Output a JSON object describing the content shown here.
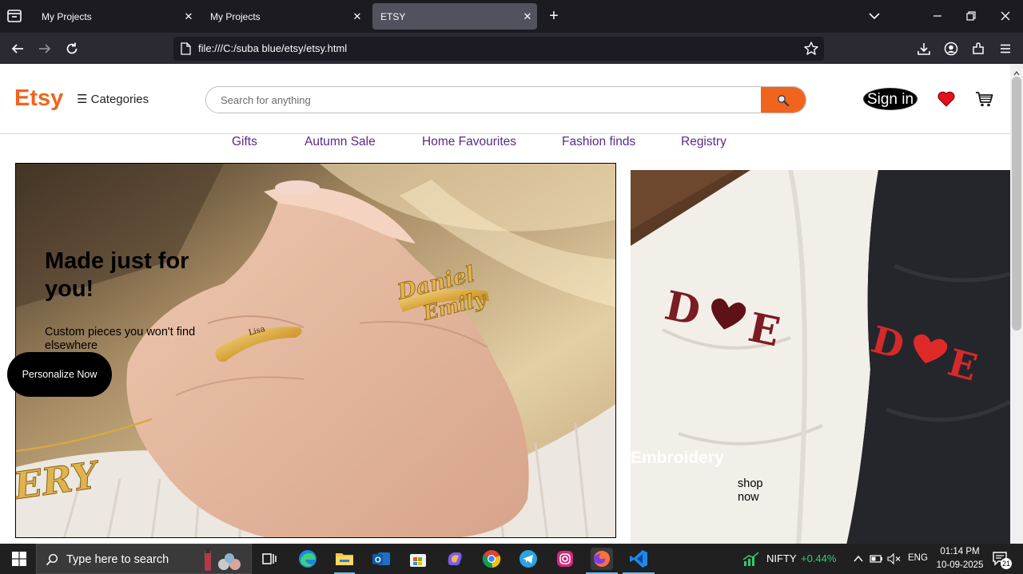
{
  "browser": {
    "tabs": [
      {
        "title": "My Projects",
        "active": false
      },
      {
        "title": "My Projects",
        "active": false
      },
      {
        "title": "ETSY",
        "active": true
      }
    ],
    "url": "file:///C:/suba blue/etsy/etsy.html"
  },
  "site": {
    "logo": "Etsy",
    "categories_label": "☰ Categories",
    "search_placeholder": "Search for anything",
    "signin_label": "Sign in",
    "brand_color": "#f1641e",
    "menu": [
      "Gifts",
      "Autumn Sale",
      "Home Favourites",
      "Fashion finds",
      "Registry"
    ]
  },
  "hero": {
    "title": "Made just for you!",
    "subtitle": "Custom pieces you won't find elsewhere",
    "cta": "Personalize Now",
    "ring_text_1": "Daniel",
    "ring_text_2": "Emily",
    "necklace_text": "ERY"
  },
  "promo": {
    "title": "Embroidery",
    "link": "shop now",
    "shirt_letters_left": "D E",
    "shirt_letters_right": "D E"
  },
  "taskbar": {
    "search_placeholder": "Type here to search",
    "stock_label": "NIFTY",
    "stock_change": "+0.44%",
    "language": "ENG",
    "time": "01:14 PM",
    "date": "10-09-2025",
    "notification_count": "21"
  }
}
